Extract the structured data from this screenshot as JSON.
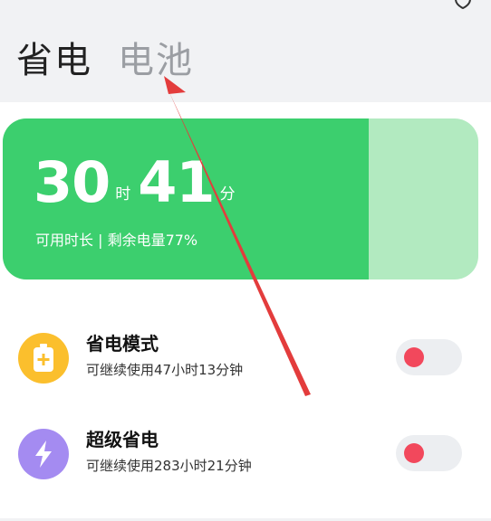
{
  "header": {
    "tab_power_saving": "省电",
    "tab_battery": "电池",
    "top_icon": "shield-icon"
  },
  "battery_card": {
    "hours": "30",
    "hours_unit": "时",
    "minutes": "41",
    "minutes_unit": "分",
    "caption": "可用时长 | 剩余电量77%",
    "level_percent": 77,
    "colors": {
      "fill": "#3ccf6e",
      "remaining": "#b2eac0"
    }
  },
  "modes": [
    {
      "title": "省电模式",
      "subtitle": "可继续使用47小时13分钟",
      "icon": "battery-plus-icon",
      "icon_color": "#fbbf2d",
      "enabled": false
    },
    {
      "title": "超级省电",
      "subtitle": "可继续使用283小时21分钟",
      "icon": "lightning-icon",
      "icon_color": "#a48bf1",
      "enabled": false
    }
  ],
  "annotation": {
    "type": "arrow",
    "color": "#e33c3c",
    "points_to": "tab-battery"
  },
  "colors": {
    "toggle_knob_off": "#f2485c",
    "toggle_track": "#eceef1"
  }
}
